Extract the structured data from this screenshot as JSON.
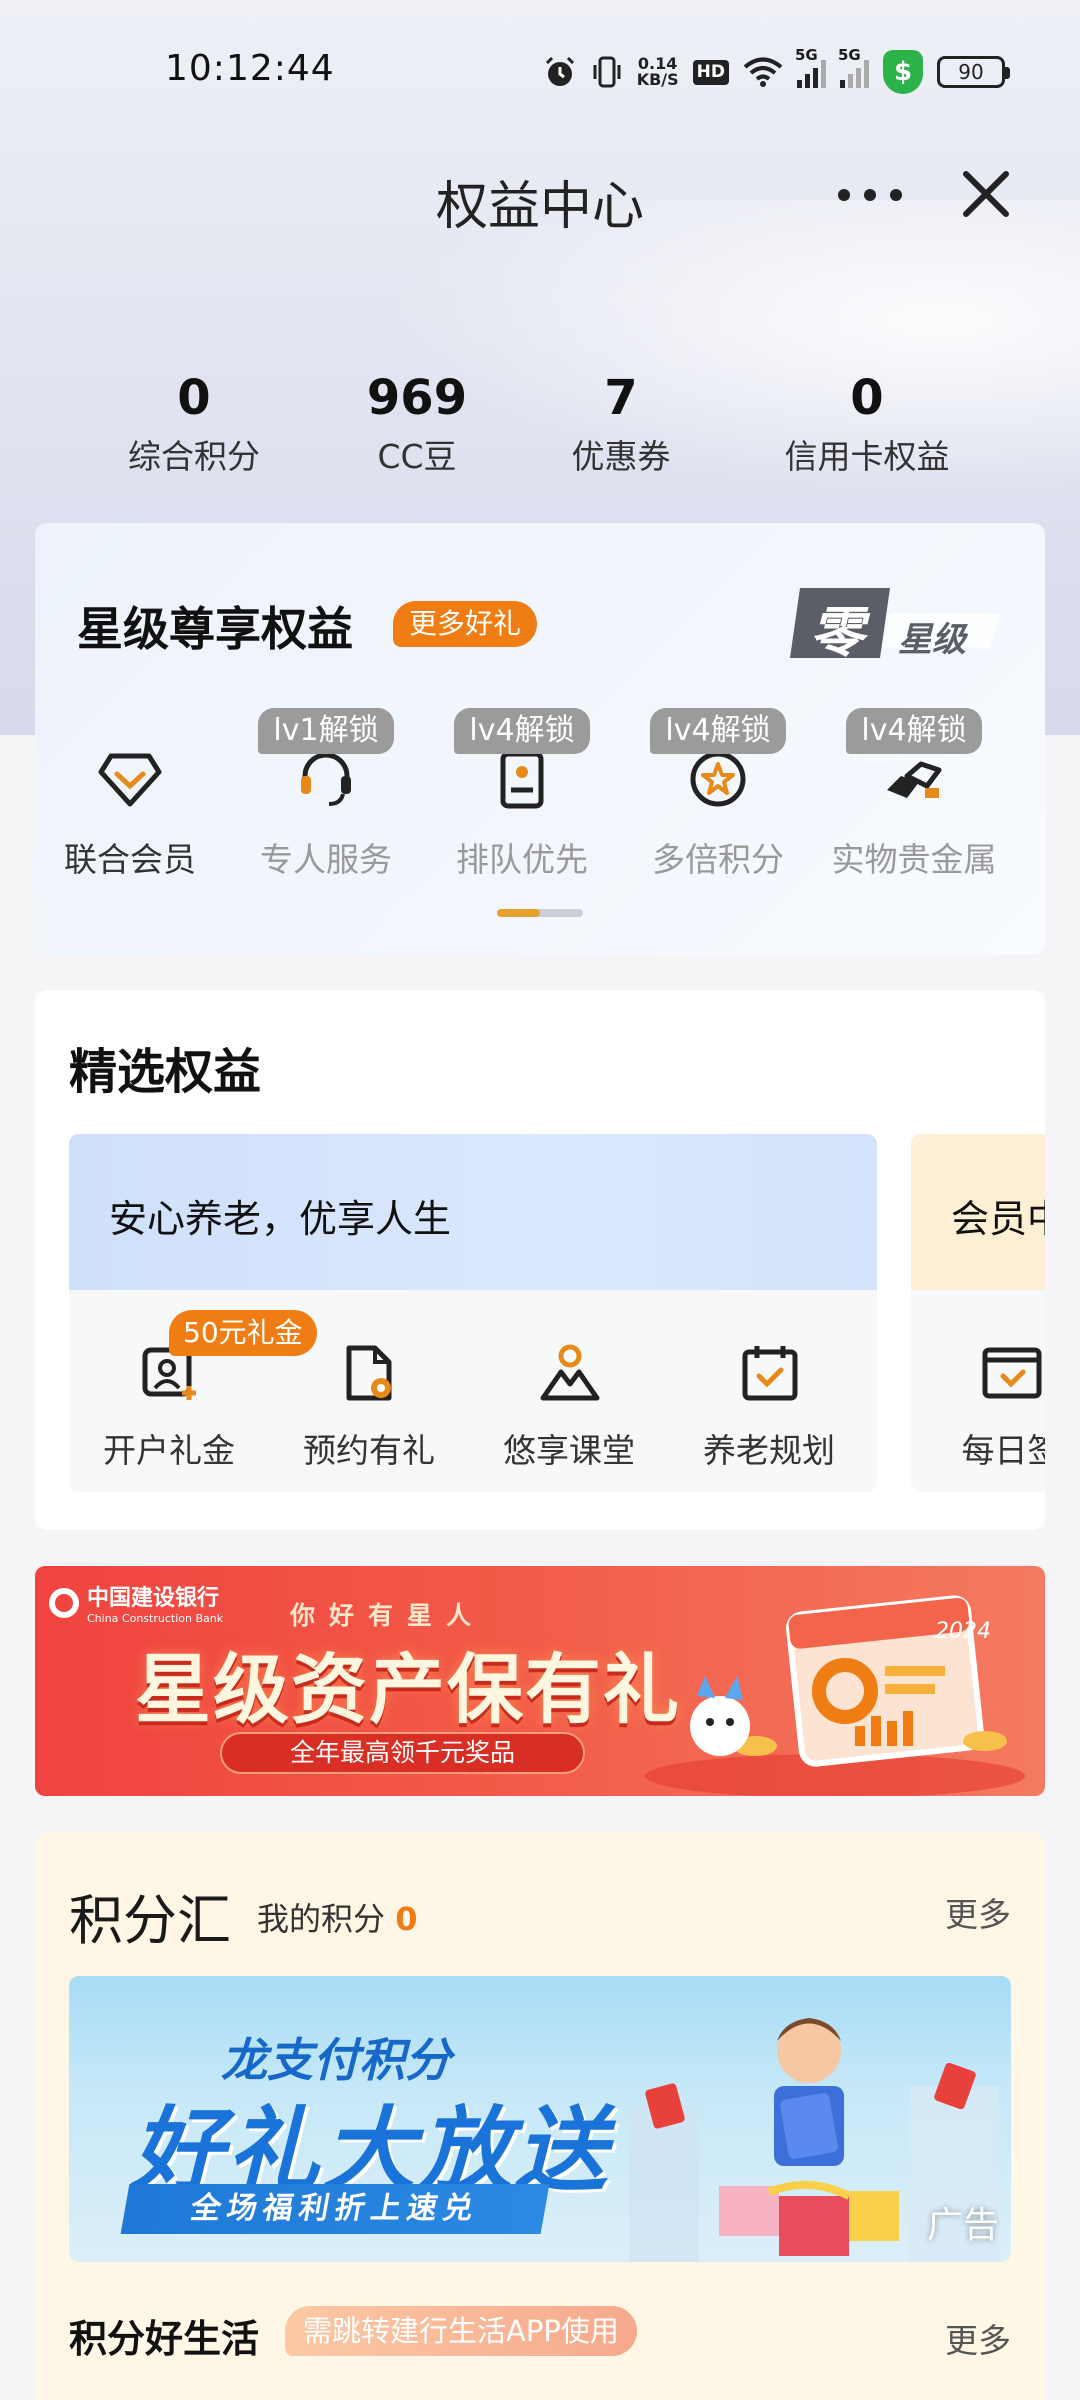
{
  "status_bar": {
    "time": "10:12:44",
    "speed_value": "0.14",
    "speed_unit": "KB/S",
    "hd": "HD",
    "signal1": "5G",
    "signal2": "5G",
    "battery": "90",
    "icons": [
      "alarm-icon",
      "vibrate-icon",
      "wifi-icon",
      "shield-icon"
    ]
  },
  "header": {
    "title": "权益中心"
  },
  "stats": [
    {
      "value": "0",
      "label": "综合积分"
    },
    {
      "value": "969",
      "label": "CC豆"
    },
    {
      "value": "7",
      "label": "优惠券"
    },
    {
      "value": "0",
      "label": "信用卡权益"
    }
  ],
  "star_benefits": {
    "title": "星级尊享权益",
    "badge": "更多好礼",
    "logo_text": "零",
    "logo_sub": "星级",
    "items": [
      {
        "label": "联合会员",
        "lock": "",
        "icon": "diamond-check-icon"
      },
      {
        "label": "专人服务",
        "lock": "lv1解锁",
        "icon": "headset-icon"
      },
      {
        "label": "排队优先",
        "lock": "lv4解锁",
        "icon": "ticket-icon"
      },
      {
        "label": "多倍积分",
        "lock": "lv4解锁",
        "icon": "star-coin-icon"
      },
      {
        "label": "实物贵金属",
        "lock": "lv4解锁",
        "icon": "gold-bars-icon"
      }
    ],
    "scroll_progress": 0.5
  },
  "selected": {
    "title": "精选权益",
    "panel1": {
      "heading": "安心养老，优享人生",
      "items": [
        {
          "label": "开户礼金",
          "tag": "50元礼金",
          "icon": "account-gift-icon"
        },
        {
          "label": "预约有礼",
          "tag": "",
          "icon": "document-coin-icon"
        },
        {
          "label": "悠享课堂",
          "tag": "",
          "icon": "mountain-person-icon"
        },
        {
          "label": "养老规划",
          "tag": "",
          "icon": "calendar-check-icon"
        }
      ]
    },
    "panel2": {
      "heading": "会员中",
      "items": [
        {
          "label": "每日签",
          "icon": "wallet-check-icon"
        }
      ]
    }
  },
  "ccb_banner": {
    "logo_cn": "中国建设银行",
    "logo_en": "China Construction Bank",
    "small": "你好有星人",
    "main": "星级资产保有礼",
    "sub": "全年最高领千元奖品",
    "year": "2024"
  },
  "points": {
    "title": "积分汇",
    "mine_label": "我的积分",
    "mine_value": "0",
    "more": "更多",
    "banner_top": "龙支付积分",
    "banner_main": "好礼大放送",
    "banner_sub": "全场福利折上速兑",
    "ad": "广告",
    "life_title": "积分好生活",
    "life_tag": "需跳转建行生活APP使用",
    "life_more": "更多"
  },
  "colors": {
    "accent_orange": "#f07c14",
    "lock_gray": "#9b9b9b",
    "ccb_red": "#f0433f",
    "points_bg": "#fff7e6"
  }
}
